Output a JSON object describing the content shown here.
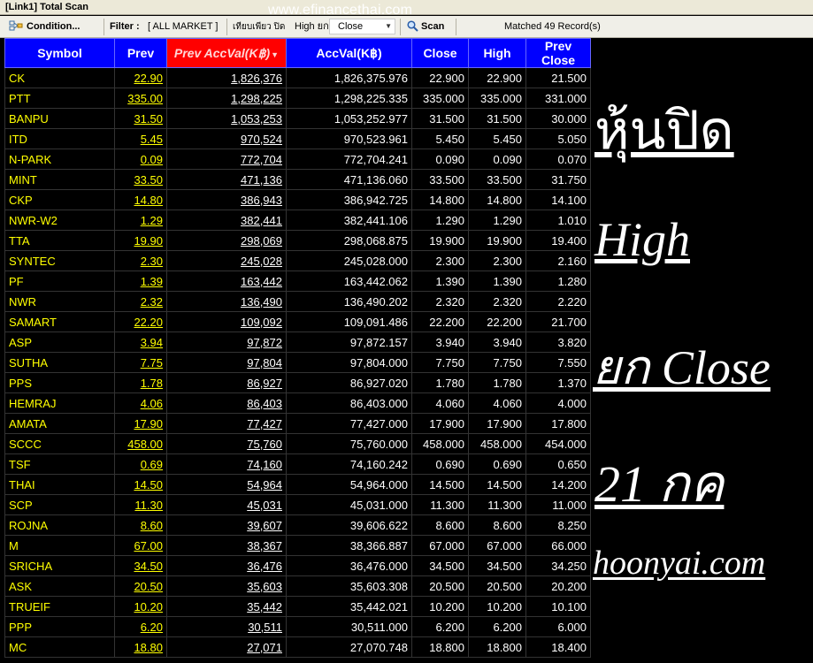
{
  "window": {
    "title": "[Link1] Total Scan"
  },
  "toolbar": {
    "condition_label": "Condition...",
    "filter_label": "Filter :",
    "filter_value": "[ ALL MARKET ]",
    "scan_type": "เทียบเพียว ปิด",
    "scan_field": "High ยก",
    "scan_select": "Close",
    "scan_label": "Scan",
    "matched": "Matched 49 Record(s)"
  },
  "watermark": "www.efinancethai.com",
  "table": {
    "headers": [
      "Symbol",
      "Prev",
      "Prev AccVal(K฿)",
      "AccVal(K฿)",
      "Close",
      "High",
      "Prev Close"
    ],
    "rows": [
      [
        "CK",
        "22.90",
        "1,826,376",
        "1,826,375.976",
        "22.900",
        "22.900",
        "21.500"
      ],
      [
        "PTT",
        "335.00",
        "1,298,225",
        "1,298,225.335",
        "335.000",
        "335.000",
        "331.000"
      ],
      [
        "BANPU",
        "31.50",
        "1,053,253",
        "1,053,252.977",
        "31.500",
        "31.500",
        "30.000"
      ],
      [
        "ITD",
        "5.45",
        "970,524",
        "970,523.961",
        "5.450",
        "5.450",
        "5.050"
      ],
      [
        "N-PARK",
        "0.09",
        "772,704",
        "772,704.241",
        "0.090",
        "0.090",
        "0.070"
      ],
      [
        "MINT",
        "33.50",
        "471,136",
        "471,136.060",
        "33.500",
        "33.500",
        "31.750"
      ],
      [
        "CKP",
        "14.80",
        "386,943",
        "386,942.725",
        "14.800",
        "14.800",
        "14.100"
      ],
      [
        "NWR-W2",
        "1.29",
        "382,441",
        "382,441.106",
        "1.290",
        "1.290",
        "1.010"
      ],
      [
        "TTA",
        "19.90",
        "298,069",
        "298,068.875",
        "19.900",
        "19.900",
        "19.400"
      ],
      [
        "SYNTEC",
        "2.30",
        "245,028",
        "245,028.000",
        "2.300",
        "2.300",
        "2.160"
      ],
      [
        "PF",
        "1.39",
        "163,442",
        "163,442.062",
        "1.390",
        "1.390",
        "1.280"
      ],
      [
        "NWR",
        "2.32",
        "136,490",
        "136,490.202",
        "2.320",
        "2.320",
        "2.220"
      ],
      [
        "SAMART",
        "22.20",
        "109,092",
        "109,091.486",
        "22.200",
        "22.200",
        "21.700"
      ],
      [
        "ASP",
        "3.94",
        "97,872",
        "97,872.157",
        "3.940",
        "3.940",
        "3.820"
      ],
      [
        "SUTHA",
        "7.75",
        "97,804",
        "97,804.000",
        "7.750",
        "7.750",
        "7.550"
      ],
      [
        "PPS",
        "1.78",
        "86,927",
        "86,927.020",
        "1.780",
        "1.780",
        "1.370"
      ],
      [
        "HEMRAJ",
        "4.06",
        "86,403",
        "86,403.000",
        "4.060",
        "4.060",
        "4.000"
      ],
      [
        "AMATA",
        "17.90",
        "77,427",
        "77,427.000",
        "17.900",
        "17.900",
        "17.800"
      ],
      [
        "SCCC",
        "458.00",
        "75,760",
        "75,760.000",
        "458.000",
        "458.000",
        "454.000"
      ],
      [
        "TSF",
        "0.69",
        "74,160",
        "74,160.242",
        "0.690",
        "0.690",
        "0.650"
      ],
      [
        "THAI",
        "14.50",
        "54,964",
        "54,964.000",
        "14.500",
        "14.500",
        "14.200"
      ],
      [
        "SCP",
        "11.30",
        "45,031",
        "45,031.000",
        "11.300",
        "11.300",
        "11.000"
      ],
      [
        "ROJNA",
        "8.60",
        "39,607",
        "39,606.622",
        "8.600",
        "8.600",
        "8.250"
      ],
      [
        "M",
        "67.00",
        "38,367",
        "38,366.887",
        "67.000",
        "67.000",
        "66.000"
      ],
      [
        "SRICHA",
        "34.50",
        "36,476",
        "36,476.000",
        "34.500",
        "34.500",
        "34.250"
      ],
      [
        "ASK",
        "20.50",
        "35,603",
        "35,603.308",
        "20.500",
        "20.500",
        "20.200"
      ],
      [
        "TRUEIF",
        "10.20",
        "35,442",
        "35,442.021",
        "10.200",
        "10.200",
        "10.100"
      ],
      [
        "PPP",
        "6.20",
        "30,511",
        "30,511.000",
        "6.200",
        "6.200",
        "6.000"
      ],
      [
        "MC",
        "18.80",
        "27,071",
        "27,070.748",
        "18.800",
        "18.800",
        "18.400"
      ]
    ]
  },
  "overlay": {
    "line1": "หุ้นปิด",
    "line2": "High",
    "line3": "ยก Close",
    "line4": "21 กค",
    "line5": "hoonyai.com"
  },
  "colors": {
    "header_bg": "#0000ff",
    "sorted_header_bg": "#ff0000",
    "symbol_text": "#ffff00",
    "value_text": "#ffffff",
    "background": "#000000"
  }
}
